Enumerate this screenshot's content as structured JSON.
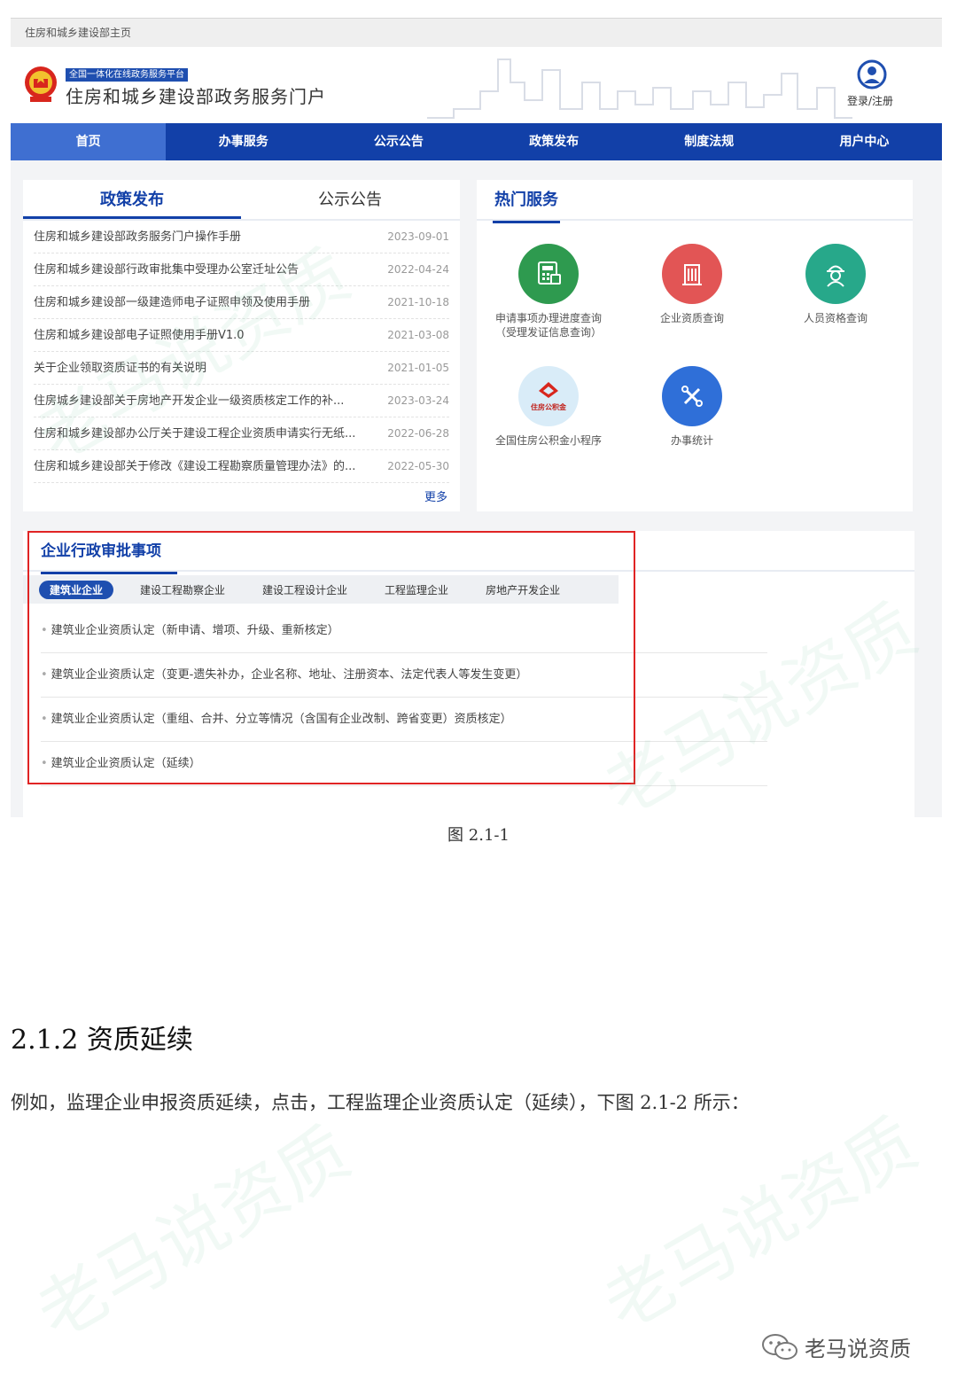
{
  "screenshot": {
    "breadcrumb": "住房和城乡建设部主页",
    "platform_tag": "全国一体化在线政务服务平台",
    "portal_title": "住房和城乡建设部政务服务门户",
    "login_label": "登录/注册",
    "nav": [
      {
        "label": "首页",
        "active": true
      },
      {
        "label": "办事服务",
        "active": false
      },
      {
        "label": "公示公告",
        "active": false
      },
      {
        "label": "政策发布",
        "active": false
      },
      {
        "label": "制度法规",
        "active": false
      },
      {
        "label": "用户中心",
        "active": false
      }
    ],
    "policy_tabs": [
      "政策发布",
      "公示公告"
    ],
    "news": [
      {
        "title": "住房和城乡建设部政务服务门户操作手册",
        "date": "2023-09-01"
      },
      {
        "title": "住房和城乡建设部行政审批集中受理办公室迁址公告",
        "date": "2022-04-24"
      },
      {
        "title": "住房和城乡建设部一级建造师电子证照申领及使用手册",
        "date": "2021-10-18"
      },
      {
        "title": "住房和城乡建设部电子证照使用手册V1.0",
        "date": "2021-03-08"
      },
      {
        "title": "关于企业领取资质证书的有关说明",
        "date": "2021-01-05"
      },
      {
        "title": "住房城乡建设部关于房地产开发企业一级资质核定工作的补...",
        "date": "2023-03-24"
      },
      {
        "title": "住房和城乡建设部办公厅关于建设工程企业资质申请实行无纸...",
        "date": "2022-06-28"
      },
      {
        "title": "住房和城乡建设部关于修改《建设工程勘察质量管理办法》的...",
        "date": "2022-05-30"
      }
    ],
    "more_label": "更多",
    "hot_title": "热门服务",
    "services": [
      {
        "line1": "申请事项办理进度查询",
        "line2": "（受理发证信息查询）",
        "color": "#2e9a4f",
        "icon": "calculator-icon"
      },
      {
        "line1": "企业资质查询",
        "line2": "",
        "color": "#e25555",
        "icon": "building-icon"
      },
      {
        "line1": "人员资格查询",
        "line2": "",
        "color": "#27a88a",
        "icon": "worker-icon"
      },
      {
        "line1": "全国住房公积金小程序",
        "line2": "",
        "color": "#d9ecf8",
        "icon": "housing-fund-logo"
      },
      {
        "line1": "办事统计",
        "line2": "",
        "color": "#2f6fd8",
        "icon": "tools-icon"
      }
    ],
    "fund_logo_text": "住房公积金",
    "approval_title": "企业行政审批事项",
    "approval_tabs": [
      {
        "label": "建筑业企业",
        "active": true
      },
      {
        "label": "建设工程勘察企业",
        "active": false
      },
      {
        "label": "建设工程设计企业",
        "active": false
      },
      {
        "label": "工程监理企业",
        "active": false
      },
      {
        "label": "房地产开发企业",
        "active": false
      }
    ],
    "approval_items": [
      "建筑业企业资质认定（新申请、增项、升级、重新核定）",
      "建筑业企业资质认定（变更-遗失补办，企业名称、地址、注册资本、法定代表人等发生变更）",
      "建筑业企业资质认定（重组、合并、分立等情况（含国有企业改制、跨省变更）资质核定）",
      "建筑业企业资质认定（延续）"
    ]
  },
  "document": {
    "caption": "图 2.1-1",
    "section_heading": "2.1.2 资质延续",
    "body_text": "例如，监理企业申报资质延续，点击，工程监理企业资质认定（延续），下图 2.1-2 所示：",
    "watermark_text": "老马说资质",
    "footer_brand": "老马说资质"
  }
}
